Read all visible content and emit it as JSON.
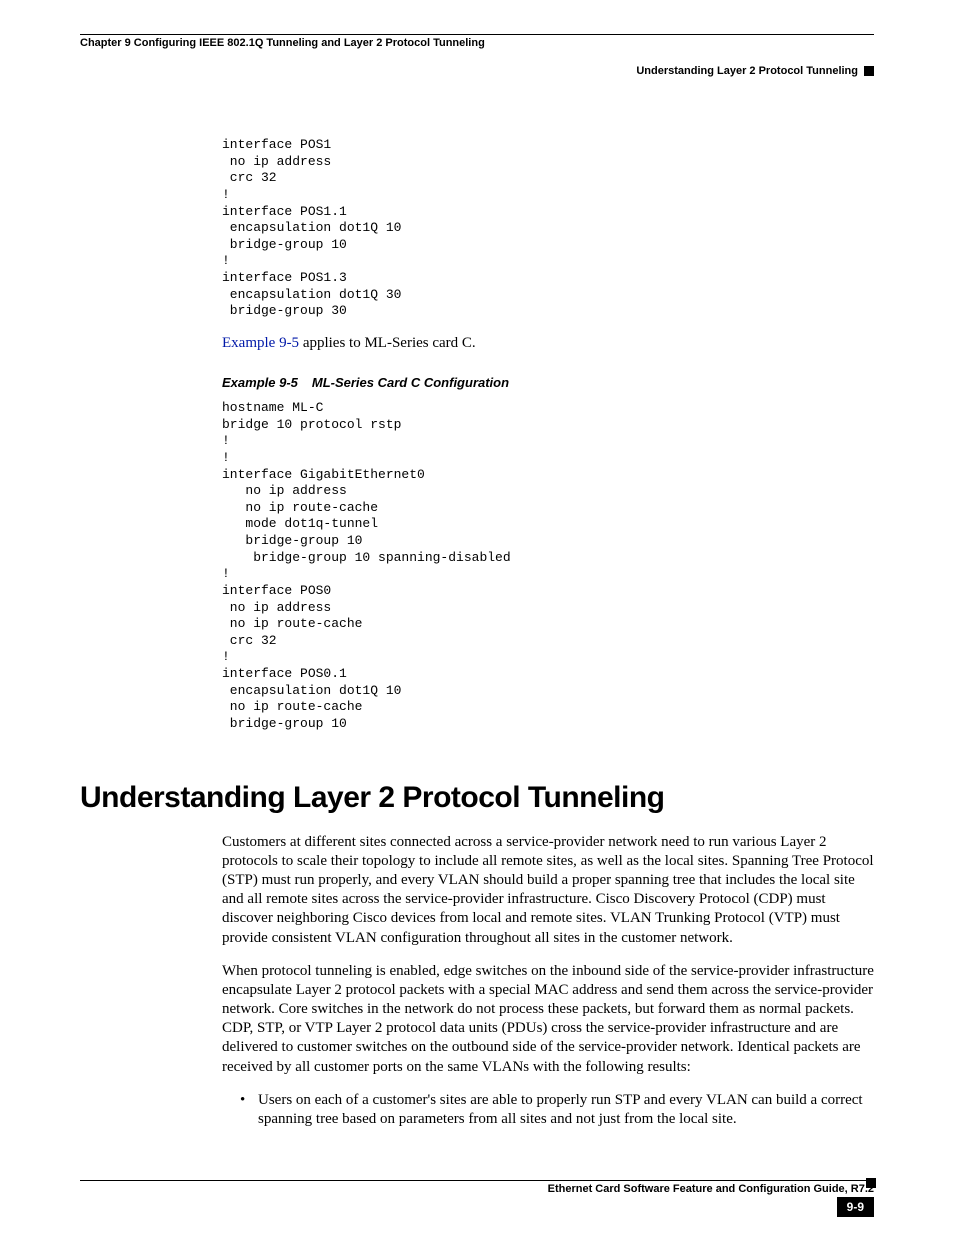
{
  "running_head": {
    "chapter": "Chapter 9      Configuring IEEE 802.1Q Tunneling and Layer 2 Protocol Tunneling",
    "section": "Understanding Layer 2 Protocol Tunneling"
  },
  "code_block_1": "interface POS1\n no ip address\n crc 32\n! \ninterface POS1.1\n encapsulation dot1Q 10\n bridge-group 10\n! \ninterface POS1.3\n encapsulation dot1Q 30\n bridge-group 30",
  "xref_sentence": {
    "link": "Example 9-5",
    "rest": " applies to ML-Series card C."
  },
  "example": {
    "number": "Example 9-5",
    "title": "ML-Series Card C Configuration"
  },
  "code_block_2": "hostname ML-C\nbridge 10 protocol rstp\n!\n!\ninterface GigabitEthernet0\n   no ip address\n   no ip route-cache\n   mode dot1q-tunnel\n   bridge-group 10\n    bridge-group 10 spanning-disabled\n!\ninterface POS0\n no ip address\n no ip route-cache\n crc 32\n! \ninterface POS0.1\n encapsulation dot1Q 10\n no ip route-cache\n bridge-group 10",
  "heading": "Understanding Layer 2 Protocol Tunneling",
  "paragraphs": {
    "p1": "Customers at different sites connected across a service-provider network need to run various Layer 2 protocols to scale their topology to include all remote sites, as well as the local sites. Spanning Tree Protocol (STP) must run properly, and every VLAN should build a proper spanning tree that includes the local site and all remote sites across the service-provider infrastructure. Cisco Discovery Protocol (CDP) must discover neighboring Cisco devices from local and remote sites. VLAN Trunking Protocol (VTP) must provide consistent VLAN configuration throughout all sites in the customer network.",
    "p2": "When protocol tunneling is enabled, edge switches on the inbound side of the service-provider infrastructure encapsulate Layer 2 protocol packets with a special MAC address and send them across the service-provider network. Core switches in the network do not process these packets, but forward them as normal packets. CDP, STP, or VTP Layer 2 protocol data units (PDUs) cross the service-provider infrastructure and are delivered to customer switches on the outbound side of the service-provider network. Identical packets are received by all customer ports on the same VLANs with the following results:"
  },
  "bullets": {
    "b1": "Users on each of a customer's sites are able to properly run STP and every VLAN can build a correct spanning tree based on parameters from all sites and not just from the local site."
  },
  "footer": {
    "guide": "Ethernet Card Software Feature and Configuration Guide, R7.2",
    "pagenum": "9-9"
  }
}
